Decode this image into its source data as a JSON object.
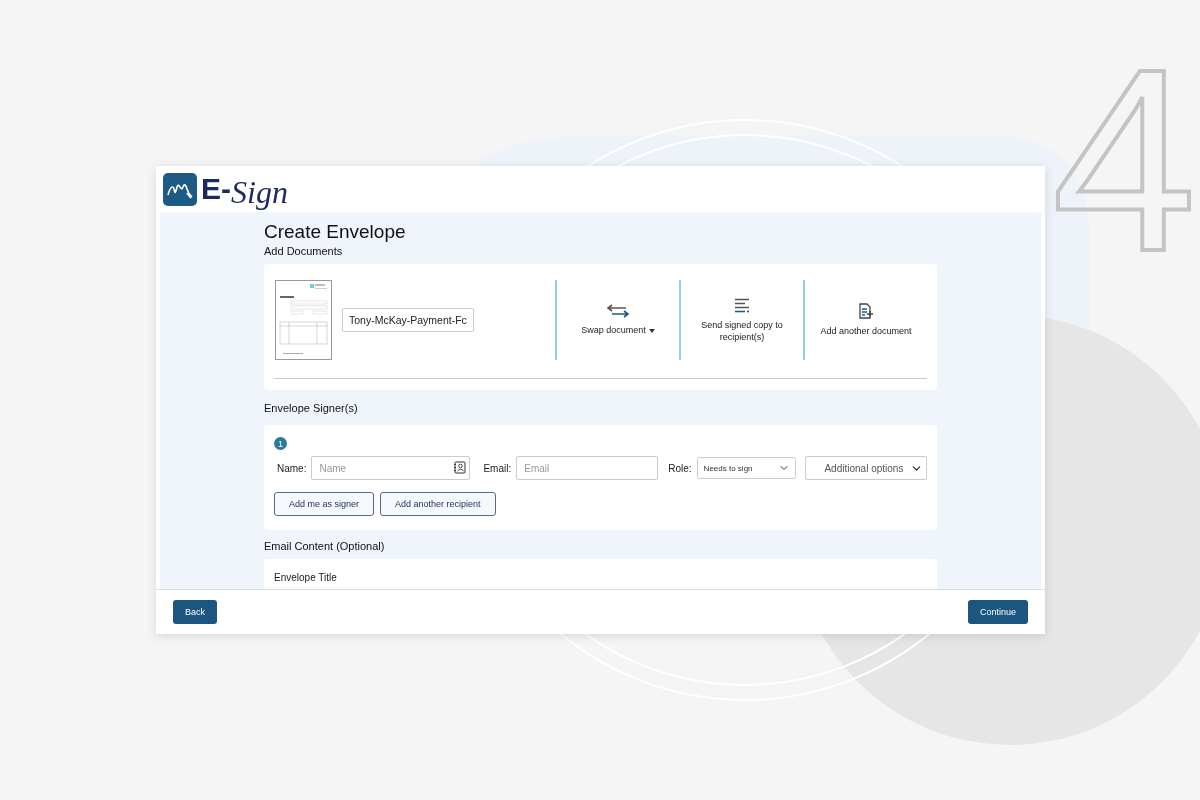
{
  "backdrop": {
    "step_number": "4"
  },
  "header": {
    "brand_prefix": "E-",
    "brand_script": "Sign"
  },
  "page": {
    "title": "Create Envelope"
  },
  "documents": {
    "heading": "Add Documents",
    "file_name": "Tony-McKay-Payment-Fc",
    "actions": [
      {
        "kind": "swap",
        "label": "Swap document",
        "dropdown": true
      },
      {
        "kind": "send",
        "label": "Send signed copy to recipient(s)",
        "dropdown": false
      },
      {
        "kind": "add",
        "label": "Add another document",
        "dropdown": false
      }
    ]
  },
  "signers": {
    "heading": "Envelope Signer(s)",
    "items": [
      {
        "number": "1",
        "name_label": "Name:",
        "name_placeholder": "Name",
        "email_label": "Email:",
        "email_placeholder": "Email",
        "role_label": "Role:",
        "role": "Needs to sign",
        "options": "Additional options"
      }
    ],
    "buttons": [
      "Add me as signer",
      "Add another recipient"
    ]
  },
  "email_content": {
    "heading": "Email Content (Optional)",
    "field_label": "Envelope Title"
  },
  "footer": {
    "back": "Back",
    "continue": "Continue"
  }
}
